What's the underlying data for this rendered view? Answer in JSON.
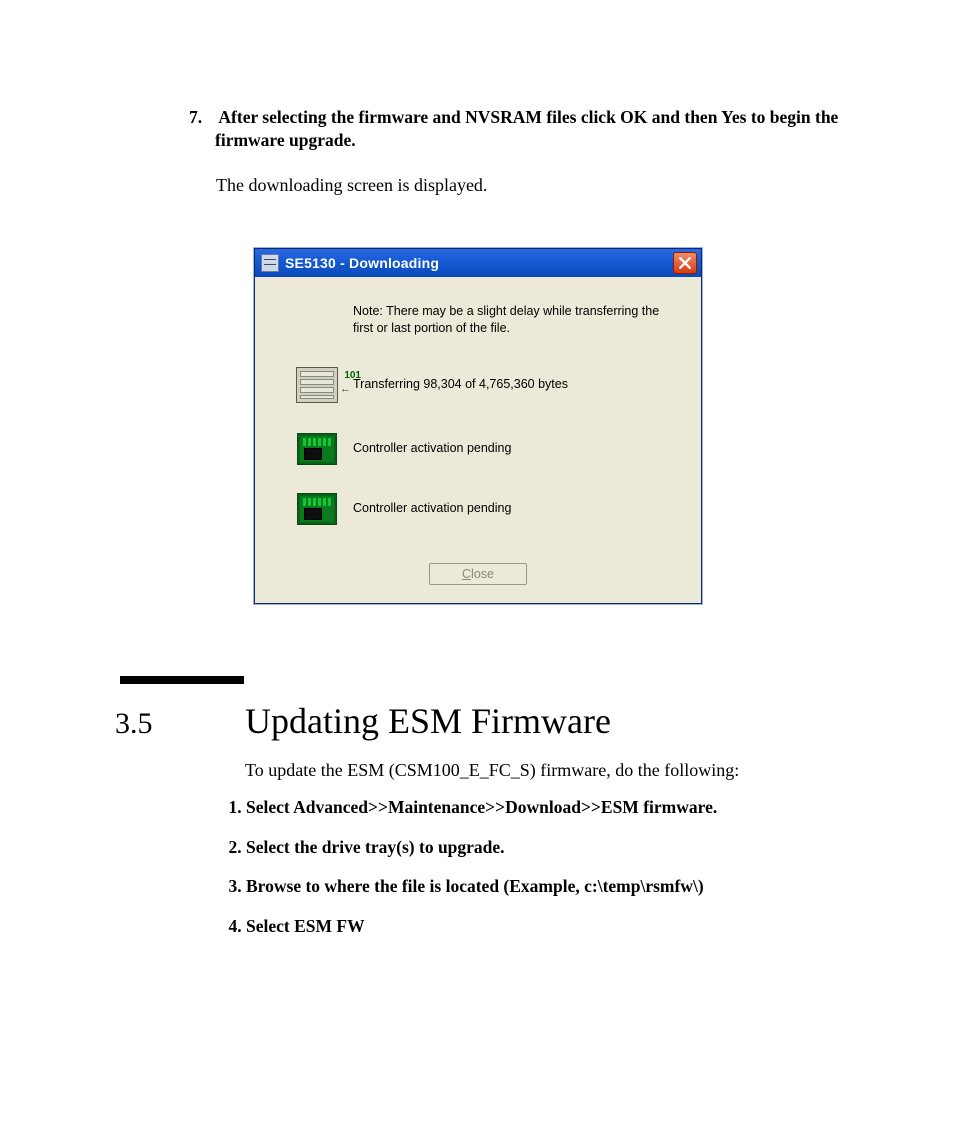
{
  "step7": {
    "number": "7.",
    "heading": "After selecting the firmware and NVSRAM files click OK and then Yes to begin the firmware upgrade.",
    "body": "The downloading screen is displayed."
  },
  "dialog": {
    "title": "SE5130 - Downloading",
    "note": "Note: There may be a slight delay while transferring the first or last portion of the file.",
    "transfer_badge": "101",
    "transfer_text": "Transferring 98,304 of 4,765,360 bytes",
    "controller_a": "Controller activation pending",
    "controller_b": "Controller activation pending",
    "close_prefix": "C",
    "close_rest": "lose"
  },
  "section": {
    "number": "3.5",
    "title": "Updating ESM Firmware",
    "intro": "To update the ESM (CSM100_E_FC_S) firmware, do the following:",
    "steps": [
      "Select Advanced>>Maintenance>>Download>>ESM firmware.",
      "Select the drive tray(s) to upgrade.",
      "Browse to where the file is located (Example, c:\\temp\\rsmfw\\)",
      "Select ESM FW"
    ]
  }
}
